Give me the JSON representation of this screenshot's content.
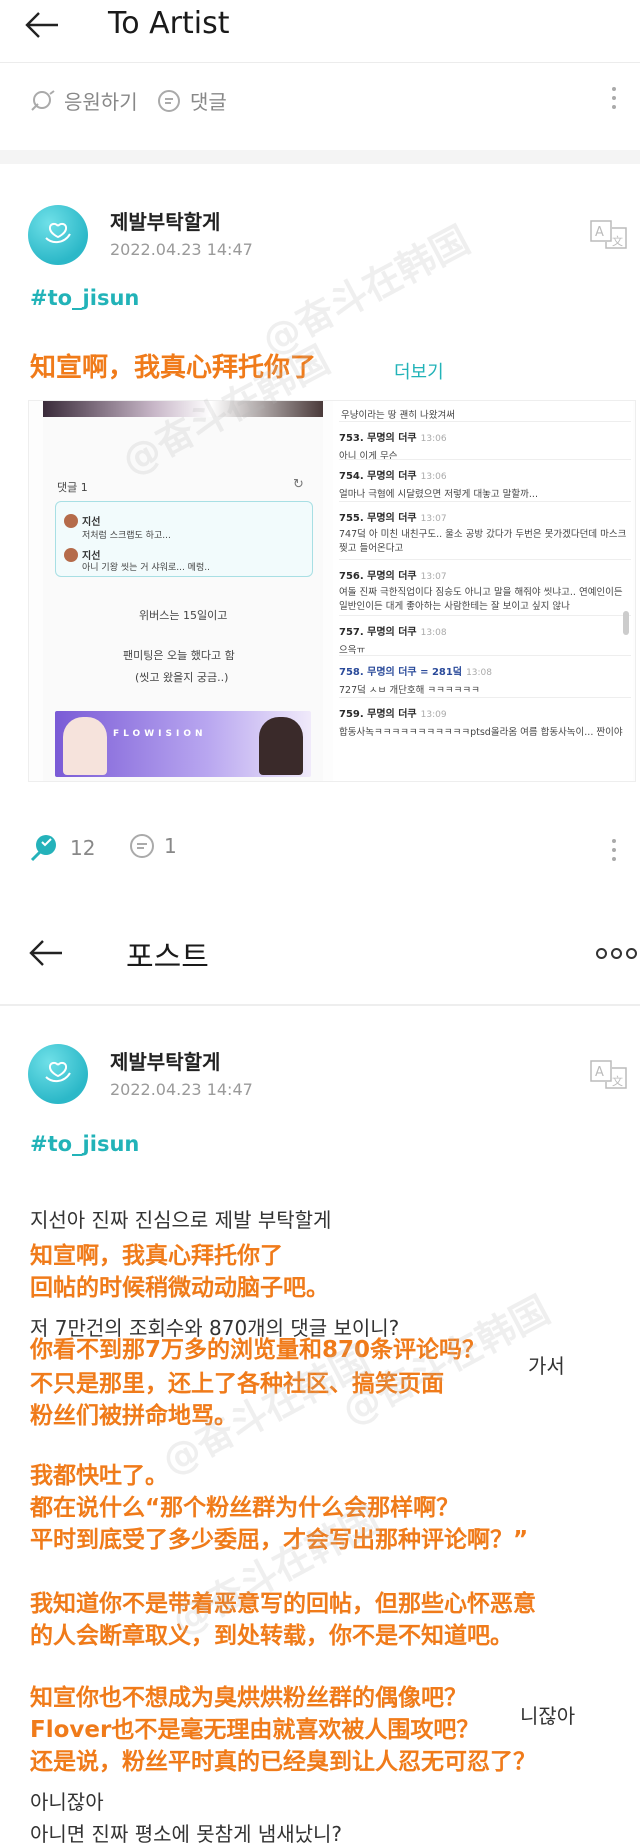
{
  "top": {
    "title": "To Artist",
    "actions": {
      "cheer_label": "응원하기",
      "comment_label": "댓글"
    }
  },
  "post1": {
    "author": "제발부탁할게",
    "date": "2022.04.23 14:47",
    "hashtag": "#to_jisun",
    "cn_line": "知宣啊，我真心拜托你了",
    "more_label": "더보기",
    "stats": {
      "cheers": "12",
      "comments": "1"
    },
    "embed": {
      "comments_header": "댓글 1",
      "c1_name": "지선",
      "c1_text": "저처럼 스크랩도 하고...",
      "c2_name": "지선",
      "c2_text": "아니 기왕 씻는 거 샤워로... 메렁..",
      "wv_line": "위버스는 15일이고",
      "fm_line": "팬미팅은 오늘 했다고 함",
      "wash_line": "(씻고 왔을지 궁금..)",
      "banner_text": "FLOWISION",
      "top_line": "우냥이라는 땅 괜히 나왔겨써",
      "items": [
        {
          "head": "753. 무명의 더쿠",
          "time": "13:06",
          "body": "아니 이게 무슨"
        },
        {
          "head": "754. 무명의 더쿠",
          "time": "13:06",
          "body": "얼마나 극혐에 시달렸으면 저렇게 대놓고 말할까..."
        },
        {
          "head": "755. 무명의 더쿠",
          "time": "13:07",
          "body": "747덬 아 미친 내친구도.. 울소 공방 갔다가 두번은 못가겠다던데 마스크 찢고 들어온다고"
        },
        {
          "head": "756. 무명의 더쿠",
          "time": "13:07",
          "body": "여돌 진짜 극한직업이다 짐승도 아니고 말을 해줘야 씻냐고.. 연예인이든 일반인이든 대게 좋아하는 사람한테는 잘 보이고 싶지 않나"
        },
        {
          "head": "757. 무명의 더쿠",
          "time": "13:08",
          "body": "으윽ㅠ"
        },
        {
          "head": "758. 무명의 더쿠 = 281덬",
          "time": "13:08",
          "body": "727덬 ㅅㅂ 개단호해 ㅋㅋㅋㅋㅋㅋ"
        },
        {
          "head": "759. 무명의 더쿠",
          "time": "13:09",
          "body": "합동사녹ㅋㅋㅋㅋㅋㅋㅋㅋㅋㅋㅋptsd올라옴 여름 합동사녹이... 짠이야"
        }
      ]
    }
  },
  "second": {
    "title": "포스트"
  },
  "post2": {
    "author": "제발부탁할게",
    "date": "2022.04.23 14:47",
    "hashtag": "#to_jisun",
    "ko_1": "지선아 진짜 진심으로 제발 부탁할게",
    "cn_1": "知宣啊，我真心拜托你了",
    "cn_2": "回帖的时候稍微动动脑子吧。",
    "ko_2": "저 7만건의 조회수와 870개의 댓글 보이니?",
    "cn_3": "你看不到那7万多的浏览量和870条评论吗？",
    "ko_3_tail": "가서",
    "cn_4": "不只是那里，还上了各种社区、搞笑页面",
    "cn_5": "粉丝们被拼命地骂。",
    "cn_6": "我都快吐了。",
    "cn_7": "都在说什么“那个粉丝群为什么会那样啊？",
    "cn_8": "平时到底受了多少委屈，才会写出那种评论啊？”",
    "cn_9": "我知道你不是带着恶意写的回帖，但那些心怀恶意",
    "cn_10": "的人会断章取义，到处转载，你不是不知道吧。",
    "cn_11": "知宣你也不想成为臭烘烘粉丝群的偶像吧？",
    "ko_4_tail": "니잖아",
    "cn_12": "Flover也不是毫无理由就喜欢被人围攻吧？",
    "cn_13": "还是说，粉丝平时真的已经臭到让人忍无可忍了？",
    "ko_5": "아니잖아",
    "ko_6": "아니면 진짜 평소에 못참게 냄새났니?"
  },
  "colors": {
    "accent": "#22b3b8",
    "overlay_text": "#f07b1a"
  },
  "watermark": "@奋斗在韩国"
}
